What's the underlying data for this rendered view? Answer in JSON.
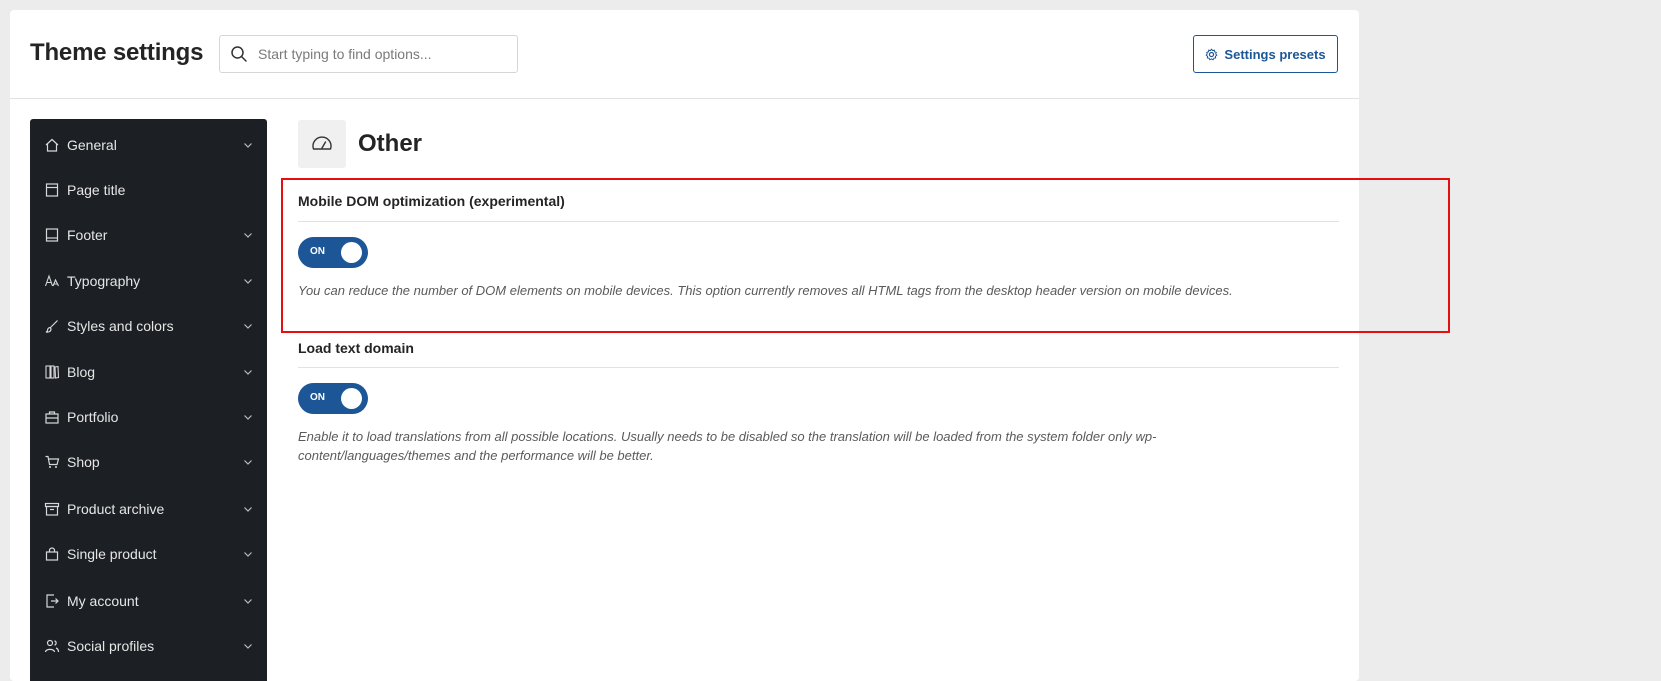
{
  "header": {
    "title": "Theme settings",
    "search_placeholder": "Start typing to find options...",
    "presets_label": "Settings presets"
  },
  "sidebar": {
    "items": [
      {
        "label": "General",
        "icon": "home-icon",
        "has_chevron": true
      },
      {
        "label": "Page title",
        "icon": "page-title-icon",
        "has_chevron": false
      },
      {
        "label": "Footer",
        "icon": "footer-icon",
        "has_chevron": true
      },
      {
        "label": "Typography",
        "icon": "typography-icon",
        "has_chevron": true
      },
      {
        "label": "Styles and colors",
        "icon": "brush-icon",
        "has_chevron": true
      },
      {
        "label": "Blog",
        "icon": "blog-icon",
        "has_chevron": true
      },
      {
        "label": "Portfolio",
        "icon": "briefcase-icon",
        "has_chevron": true
      },
      {
        "label": "Shop",
        "icon": "cart-icon",
        "has_chevron": true
      },
      {
        "label": "Product archive",
        "icon": "archive-icon",
        "has_chevron": true
      },
      {
        "label": "Single product",
        "icon": "bag-icon",
        "has_chevron": true
      },
      {
        "label": "My account",
        "icon": "account-icon",
        "has_chevron": true
      },
      {
        "label": "Social profiles",
        "icon": "users-icon",
        "has_chevron": true
      }
    ]
  },
  "section": {
    "title": "Other",
    "icon": "speedometer-icon"
  },
  "options": [
    {
      "title": "Mobile DOM optimization (experimental)",
      "toggle_label": "ON",
      "enabled": true,
      "description": "You can reduce the number of DOM elements on mobile devices. This option currently removes all HTML tags from the desktop header version on mobile devices."
    },
    {
      "title": "Load text domain",
      "toggle_label": "ON",
      "enabled": true,
      "description_line1": "Enable it to load translations from all possible locations. Usually needs to be disabled so the translation will be loaded from the system folder only wp-",
      "description_line2": "content/languages/themes and the performance will be better."
    }
  ],
  "colors": {
    "accent": "#1c5696",
    "sidebar_bg": "#1c1f23",
    "highlight": "#e50f0f"
  }
}
